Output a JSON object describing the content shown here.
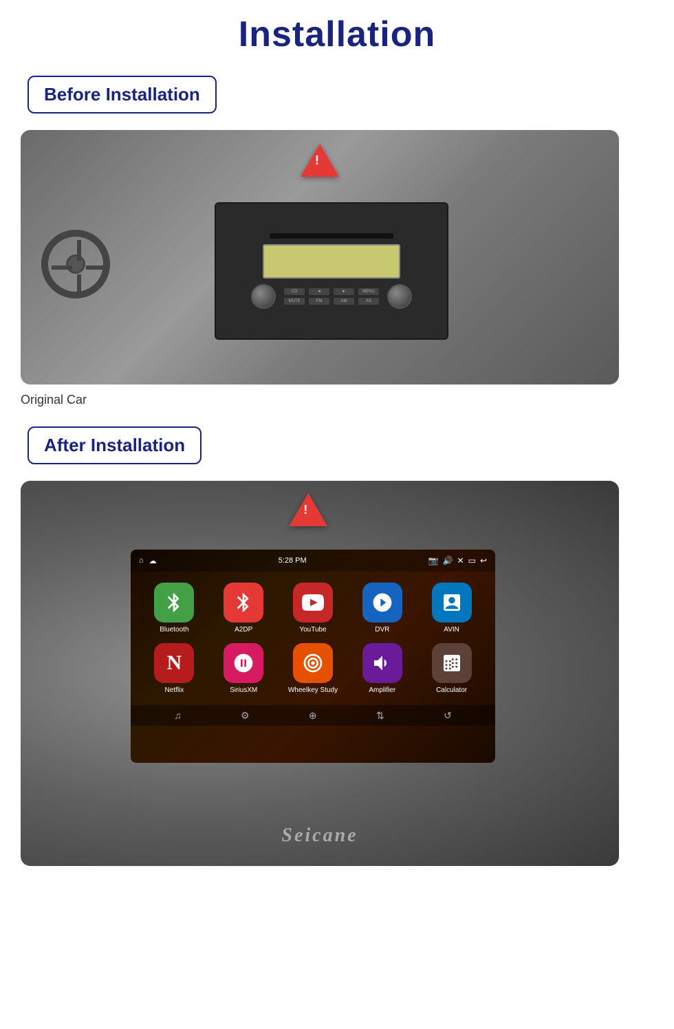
{
  "page": {
    "title": "Installation"
  },
  "before_section": {
    "label": "Before Installation",
    "caption": "Original Car"
  },
  "after_section": {
    "label": "After Installation",
    "seicane": "Seicane"
  },
  "apps": {
    "row1": [
      {
        "id": "bluetooth",
        "label": "Bluetooth",
        "color": "#43a047",
        "icon": "bluetooth"
      },
      {
        "id": "a2dp",
        "label": "A2DP",
        "color": "#e53935",
        "icon": "bluetooth2"
      },
      {
        "id": "youtube",
        "label": "YouTube",
        "color": "#c62828",
        "icon": "youtube"
      },
      {
        "id": "dvr",
        "label": "DVR",
        "color": "#1565c0",
        "icon": "dvr"
      },
      {
        "id": "avin",
        "label": "AVIN",
        "color": "#0277bd",
        "icon": "avin"
      }
    ],
    "row2": [
      {
        "id": "netflix",
        "label": "Netflix",
        "color": "#b71c1c",
        "icon": "netflix"
      },
      {
        "id": "siriusxm",
        "label": "SiriusXM",
        "color": "#d81b60",
        "icon": "siriusxm"
      },
      {
        "id": "wheelkey",
        "label": "Wheelkey Study",
        "color": "#e65100",
        "icon": "wheelkey"
      },
      {
        "id": "amplifier",
        "label": "Amplifier",
        "color": "#6a1b9a",
        "icon": "amplifier"
      },
      {
        "id": "calculator",
        "label": "Calculator",
        "color": "#5d4037",
        "icon": "calculator"
      }
    ]
  },
  "statusbar": {
    "time": "5:28 PM"
  }
}
